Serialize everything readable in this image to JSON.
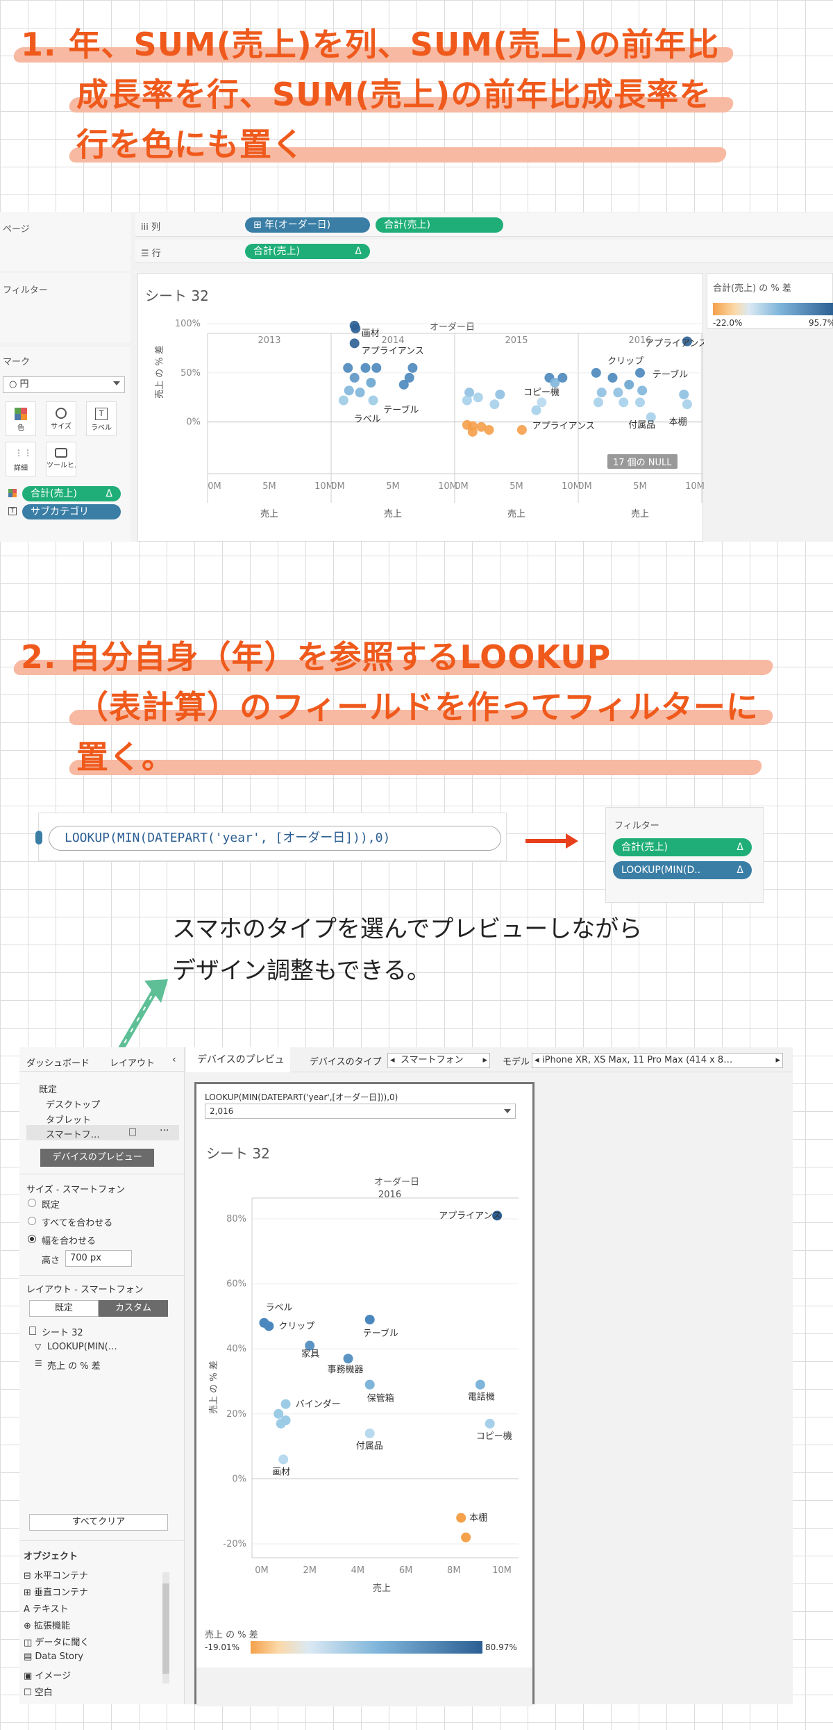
{
  "step1": {
    "lines": [
      "1. 年、SUM(売上)を列、SUM(売上)の前年比",
      "成長率を行、SUM(売上)の前年比成長率を",
      "行を色にも置く"
    ]
  },
  "step2": {
    "lines": [
      "2. 自分自身（年）を参照するLOOKUP",
      "（表計算）のフィールドを作ってフィルターに",
      "置く。"
    ]
  },
  "callout": {
    "lines": [
      "スマホのタイプを選んでプレビューしながら",
      "デザイン調整もできる。"
    ]
  },
  "ws1": {
    "pages_label": "ページ",
    "filters_label": "フィルター",
    "marks_label": "マーク",
    "mark_type": "○ 円",
    "mark_buttons": [
      "色",
      "サイズ",
      "ラベル",
      "詳細",
      "ツールヒ…"
    ],
    "columns_label": "iii 列",
    "rows_label": "☰ 行",
    "col_pills": [
      "⊞ 年(オーダー日)",
      "合計(売上)"
    ],
    "row_pill": "合計(売上)",
    "delta": "Δ",
    "mark_pills": [
      "合計(売上)",
      "サブカテゴリ"
    ],
    "sheet_title": "シート 32",
    "legend_title": "合計(売上) の % 差",
    "legend_min": "-22.0%",
    "legend_max": "95.7%",
    "null_badge": "17 個の NULL"
  },
  "colors": {
    "accent_orange": "#ef5a1c",
    "pill_green": "#1fae78",
    "pill_blue": "#3a7ea6",
    "dark_blue": "#2c5f93",
    "light_blue": "#9ccbe6",
    "orange_point": "#f5a04a"
  },
  "chart_data": [
    {
      "type": "scatter",
      "title": "シート 32",
      "top_label": "オーダー日",
      "panels": [
        "2013",
        "2014",
        "2015",
        "2016"
      ],
      "xlabel": "売上",
      "ylabel": "売上 の % 差",
      "x_ticks": [
        "0M",
        "5M",
        "10M"
      ],
      "y_ticks": [
        "100%",
        "50%",
        "0%"
      ],
      "xlim": [
        0,
        10000000
      ],
      "ylim": [
        -20,
        100
      ],
      "point_labels": [
        {
          "panel": "2014",
          "text": "画材",
          "x": 1500000,
          "y": 90
        },
        {
          "panel": "2014",
          "text": "アプライアンス",
          "x": 1500000,
          "y": 72
        },
        {
          "panel": "2014",
          "text": "テーブル",
          "x": 3500000,
          "y": 12
        },
        {
          "panel": "2014",
          "text": "ラベル",
          "x": 800000,
          "y": 3
        },
        {
          "panel": "2015",
          "text": "コピー機",
          "x": 5000000,
          "y": 30
        },
        {
          "panel": "2015",
          "text": "アプライアンス",
          "x": 5800000,
          "y": -4
        },
        {
          "panel": "2016",
          "text": "アプライアンス",
          "x": 4800000,
          "y": 80
        },
        {
          "panel": "2016",
          "text": "クリップ",
          "x": 1400000,
          "y": 62
        },
        {
          "panel": "2016",
          "text": "テーブル",
          "x": 5500000,
          "y": 48
        },
        {
          "panel": "2016",
          "text": "付属品",
          "x": 3300000,
          "y": -3
        },
        {
          "panel": "2016",
          "text": "本棚",
          "x": 7000000,
          "y": 0
        }
      ],
      "points": [
        {
          "panel": "2014",
          "x": 1500000,
          "y": 98,
          "c": "#2c5f93"
        },
        {
          "panel": "2014",
          "x": 1600000,
          "y": 95,
          "c": "#2c5f93"
        },
        {
          "panel": "2014",
          "x": 1500000,
          "y": 80,
          "c": "#2c5f93"
        },
        {
          "panel": "2014",
          "x": 900000,
          "y": 55,
          "c": "#4a87bd"
        },
        {
          "panel": "2014",
          "x": 2500000,
          "y": 55,
          "c": "#4a87bd"
        },
        {
          "panel": "2014",
          "x": 3500000,
          "y": 55,
          "c": "#4a87bd"
        },
        {
          "panel": "2014",
          "x": 6800000,
          "y": 55,
          "c": "#4a87bd"
        },
        {
          "panel": "2014",
          "x": 1500000,
          "y": 45,
          "c": "#5c95c4"
        },
        {
          "panel": "2014",
          "x": 3000000,
          "y": 40,
          "c": "#6aa5cf"
        },
        {
          "panel": "2014",
          "x": 6500000,
          "y": 45,
          "c": "#4a87bd"
        },
        {
          "panel": "2014",
          "x": 6000000,
          "y": 38,
          "c": "#4a87bd"
        },
        {
          "panel": "2014",
          "x": 1000000,
          "y": 32,
          "c": "#7fb5da"
        },
        {
          "panel": "2014",
          "x": 2000000,
          "y": 30,
          "c": "#7fb5da"
        },
        {
          "panel": "2014",
          "x": 500000,
          "y": 22,
          "c": "#9ccbe6"
        },
        {
          "panel": "2014",
          "x": 3200000,
          "y": 22,
          "c": "#9ccbe6"
        },
        {
          "panel": "2015",
          "x": 700000,
          "y": 30,
          "c": "#8ec0e1"
        },
        {
          "panel": "2015",
          "x": 1500000,
          "y": 25,
          "c": "#a6d0ea"
        },
        {
          "panel": "2015",
          "x": 3500000,
          "y": 28,
          "c": "#8ec0e1"
        },
        {
          "panel": "2015",
          "x": 3000000,
          "y": 18,
          "c": "#a6d0ea"
        },
        {
          "panel": "2015",
          "x": 500000,
          "y": 22,
          "c": "#a6d0ea"
        },
        {
          "panel": "2015",
          "x": 6800000,
          "y": 12,
          "c": "#a6d0ea"
        },
        {
          "panel": "2015",
          "x": 7300000,
          "y": 20,
          "c": "#b8d9ee"
        },
        {
          "panel": "2015",
          "x": 8000000,
          "y": 45,
          "c": "#4a87bd"
        },
        {
          "panel": "2015",
          "x": 8500000,
          "y": 40,
          "c": "#7fb5da"
        },
        {
          "panel": "2015",
          "x": 9200000,
          "y": 45,
          "c": "#4a87bd"
        },
        {
          "panel": "2015",
          "x": 1000000,
          "y": -4,
          "c": "#f5a04a"
        },
        {
          "panel": "2015",
          "x": 1800000,
          "y": -5,
          "c": "#f5a04a"
        },
        {
          "panel": "2015",
          "x": 500000,
          "y": -3,
          "c": "#f5a04a"
        },
        {
          "panel": "2015",
          "x": 2500000,
          "y": -8,
          "c": "#f5a04a"
        },
        {
          "panel": "2015",
          "x": 1000000,
          "y": -10,
          "c": "#f5a04a"
        },
        {
          "panel": "2015",
          "x": 5500000,
          "y": -8,
          "c": "#f5a04a"
        },
        {
          "panel": "2016",
          "x": 9300000,
          "y": 82,
          "c": "#2c5f93"
        },
        {
          "panel": "2016",
          "x": 1000000,
          "y": 50,
          "c": "#4a87bd"
        },
        {
          "panel": "2016",
          "x": 2500000,
          "y": 45,
          "c": "#4a87bd"
        },
        {
          "panel": "2016",
          "x": 5000000,
          "y": 50,
          "c": "#4a87bd"
        },
        {
          "panel": "2016",
          "x": 4000000,
          "y": 38,
          "c": "#6aa5cf"
        },
        {
          "panel": "2016",
          "x": 1500000,
          "y": 30,
          "c": "#8ec0e1"
        },
        {
          "panel": "2016",
          "x": 3000000,
          "y": 30,
          "c": "#8ec0e1"
        },
        {
          "panel": "2016",
          "x": 5200000,
          "y": 32,
          "c": "#7fb5da"
        },
        {
          "panel": "2016",
          "x": 9000000,
          "y": 28,
          "c": "#8ec0e1"
        },
        {
          "panel": "2016",
          "x": 1200000,
          "y": 20,
          "c": "#a6d0ea"
        },
        {
          "panel": "2016",
          "x": 3500000,
          "y": 20,
          "c": "#a6d0ea"
        },
        {
          "panel": "2016",
          "x": 5000000,
          "y": 20,
          "c": "#a6d0ea"
        },
        {
          "panel": "2016",
          "x": 9300000,
          "y": 18,
          "c": "#a6d0ea"
        },
        {
          "panel": "2016",
          "x": 6000000,
          "y": 5,
          "c": "#a6d0ea"
        }
      ]
    },
    {
      "type": "scatter",
      "title": "シート 32",
      "top_label": "オーダー日",
      "panel": "2016",
      "xlabel": "売上",
      "ylabel": "売上 の % 差",
      "x_ticks": [
        "0M",
        "2M",
        "4M",
        "6M",
        "8M",
        "10M"
      ],
      "y_ticks": [
        "80%",
        "60%",
        "40%",
        "20%",
        "0%",
        "-20%"
      ],
      "xlim": [
        0,
        10000000
      ],
      "ylim": [
        -20,
        80
      ],
      "points": [
        {
          "label": "アプライアンス",
          "x": 9800000,
          "y": 81,
          "c": "#2c5f93"
        },
        {
          "label": "ラベル",
          "x": 100000,
          "y": 48,
          "c": "#4a87bd"
        },
        {
          "label": "クリップ",
          "x": 300000,
          "y": 47,
          "c": "#4a87bd"
        },
        {
          "label": "テーブル",
          "x": 4500000,
          "y": 49,
          "c": "#4a87bd"
        },
        {
          "label": "家具",
          "x": 2000000,
          "y": 41,
          "c": "#5c95c4"
        },
        {
          "label": "事務機器",
          "x": 3600000,
          "y": 37,
          "c": "#5c95c4"
        },
        {
          "label": "保管箱",
          "x": 4500000,
          "y": 29,
          "c": "#7fb5da"
        },
        {
          "label": "バインダー",
          "x": 1000000,
          "y": 23,
          "c": "#9ccbe6"
        },
        {
          "label": "",
          "x": 700000,
          "y": 20,
          "c": "#9ccbe6"
        },
        {
          "label": "",
          "x": 1000000,
          "y": 18,
          "c": "#9ccbe6"
        },
        {
          "label": "",
          "x": 800000,
          "y": 17,
          "c": "#9ccbe6"
        },
        {
          "label": "電話機",
          "x": 9100000,
          "y": 29,
          "c": "#7fb5da"
        },
        {
          "label": "コピー機",
          "x": 9500000,
          "y": 17,
          "c": "#a6d0ea"
        },
        {
          "label": "付属品",
          "x": 4500000,
          "y": 14,
          "c": "#b8d9ee"
        },
        {
          "label": "画材",
          "x": 900000,
          "y": 6,
          "c": "#b8d9ee"
        },
        {
          "label": "本棚",
          "x": 8300000,
          "y": -12,
          "c": "#f5a04a"
        },
        {
          "label": "",
          "x": 8500000,
          "y": -18,
          "c": "#f5a04a"
        }
      ]
    }
  ],
  "calc": {
    "formula": "LOOKUP(MIN(DATEPART('year', [オーダー日])),0)"
  },
  "filters_card": {
    "title": "フィルター",
    "items": [
      "合計(売上)",
      "LOOKUP(MIN(D.."
    ],
    "delta": "Δ"
  },
  "dash": {
    "tabs": [
      "ダッシュボード",
      "レイアウト"
    ],
    "default": "既定",
    "devices": [
      "デスクトップ",
      "タブレット",
      "スマートフ…"
    ],
    "preview_btn": "デバイスのプレビュー",
    "size_title": "サイズ - スマートフォン",
    "size_opts": [
      "既定",
      "すべてを合わせる",
      "幅を合わせる"
    ],
    "height_label": "高さ",
    "height_value": "700 px",
    "layout_title": "レイアウト - スマートフォン",
    "layout_btns": [
      "既定",
      "カスタム"
    ],
    "layout_items": [
      "シート 32",
      "LOOKUP(MIN(…",
      "売上 の % 差"
    ],
    "clear_btn": "すべてクリア",
    "objects_title": "オブジェクト",
    "objects": [
      "水平コンテナ",
      "垂直コンテナ",
      "テキスト",
      "拡張機能",
      "データに聞く",
      "Data Story",
      "イメージ",
      "空白"
    ],
    "toolbar": {
      "preview_tab": "デバイスのプレビュー",
      "device_type_label": "デバイスのタイプ",
      "device_type": "スマートフォン",
      "model_label": "モデル",
      "model": "iPhone XR, XS Max, 11 Pro Max (414 x 8…"
    },
    "filter_title": "LOOKUP(MIN(DATEPART('year',[オーダー日])),0)",
    "filter_value": "2,016",
    "legend_title": "売上 の % 差",
    "legend_min": "-19.01%",
    "legend_max": "80.97%"
  }
}
